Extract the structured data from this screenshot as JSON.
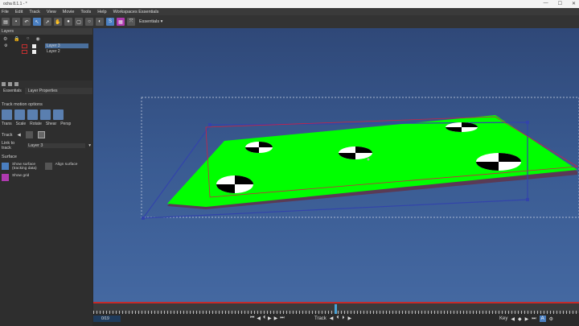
{
  "window": {
    "title": "ocha 8.1.1 - *",
    "controls": [
      "—",
      "☐",
      "✕"
    ]
  },
  "menu": [
    "File",
    "Edit",
    "Track",
    "View",
    "Movie",
    "Tools",
    "Help",
    "Workspaces Essentials"
  ],
  "toolbar": {
    "workspace_label": "Essentials ▾"
  },
  "layers_panel": {
    "title": "Layers",
    "layers": [
      {
        "name": "Layer 3",
        "selected": true
      },
      {
        "name": "Layer 2",
        "selected": false
      }
    ]
  },
  "tabs": [
    "Essentials",
    "Layer Properties"
  ],
  "track_motion": {
    "title": "Track motion options",
    "buttons": [
      "Trans",
      "Scale",
      "Rotate",
      "Shear",
      "Persp"
    ]
  },
  "track": {
    "label": "Track"
  },
  "link_to_track": {
    "label": "Link to track",
    "value": "Layer 3"
  },
  "surface": {
    "title": "Surface",
    "show_surface": "Show surface",
    "show_surface_sub": "(tracking data)",
    "align_surface": "Align surface",
    "show_grid": "Show grid"
  },
  "timeline": {
    "frame": "0/19",
    "track_label": "Track",
    "key_label": "Key",
    "key_button": "A"
  },
  "colors": {
    "plane": "#00ff00",
    "accent": "#4a7fc1",
    "timeline_border": "#c42a2a",
    "surface_outline": "#3344aa"
  }
}
